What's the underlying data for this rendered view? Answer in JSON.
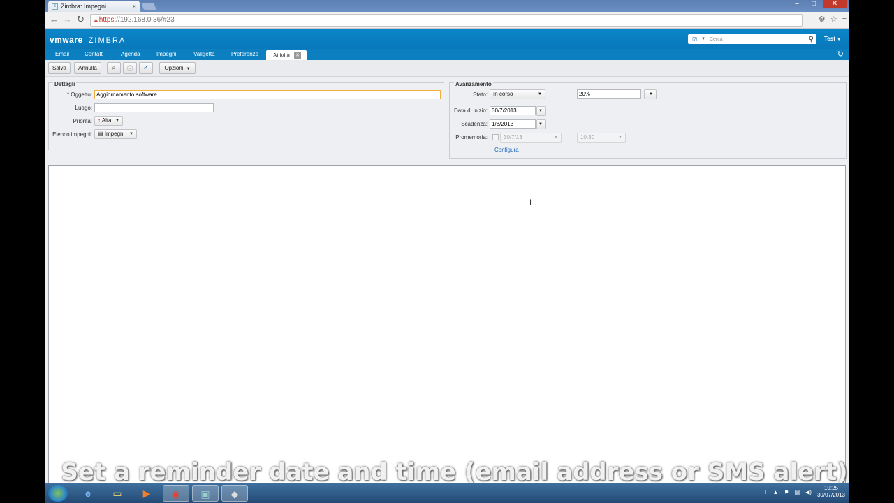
{
  "browser": {
    "tab_title": "Zimbra: Impegni",
    "tab_close": "×",
    "url_https": "https",
    "url_rest": "://192.168.0.36/#23"
  },
  "app": {
    "brand": "vmware",
    "product": "ZIMBRA",
    "search_placeholder": "Cerca",
    "user": "Test",
    "nav": [
      "Email",
      "Contatti",
      "Agenda",
      "Impegni",
      "Valigetta",
      "Preferenze"
    ],
    "active_tab": "Attività"
  },
  "toolbar": {
    "save": "Salva",
    "cancel": "Annulla",
    "options": "Opzioni"
  },
  "details": {
    "legend": "Dettagli",
    "subject_label": "* Oggetto:",
    "subject_value": "Aggiornamento software",
    "location_label": "Luogo:",
    "location_value": "",
    "priority_label": "Priorità:",
    "priority_value": "Alta",
    "list_label": "Elenco impegni:",
    "list_value": "Impegni"
  },
  "progress": {
    "legend": "Avanzamento",
    "status_label": "Stato:",
    "status_value": "In corso",
    "percent_value": "20%",
    "start_label": "Data di inizio:",
    "start_value": "30/7/2013",
    "due_label": "Scadenza:",
    "due_value": "1/8/2013",
    "reminder_label": "Promemoria:",
    "reminder_date": "30/7/13",
    "reminder_time": "10:30",
    "configure_link": "Configura"
  },
  "caption": "Set a reminder date and time (email address or SMS alert)",
  "taskbar": {
    "lang": "IT",
    "time": "10:25",
    "date": "30/07/2013"
  }
}
